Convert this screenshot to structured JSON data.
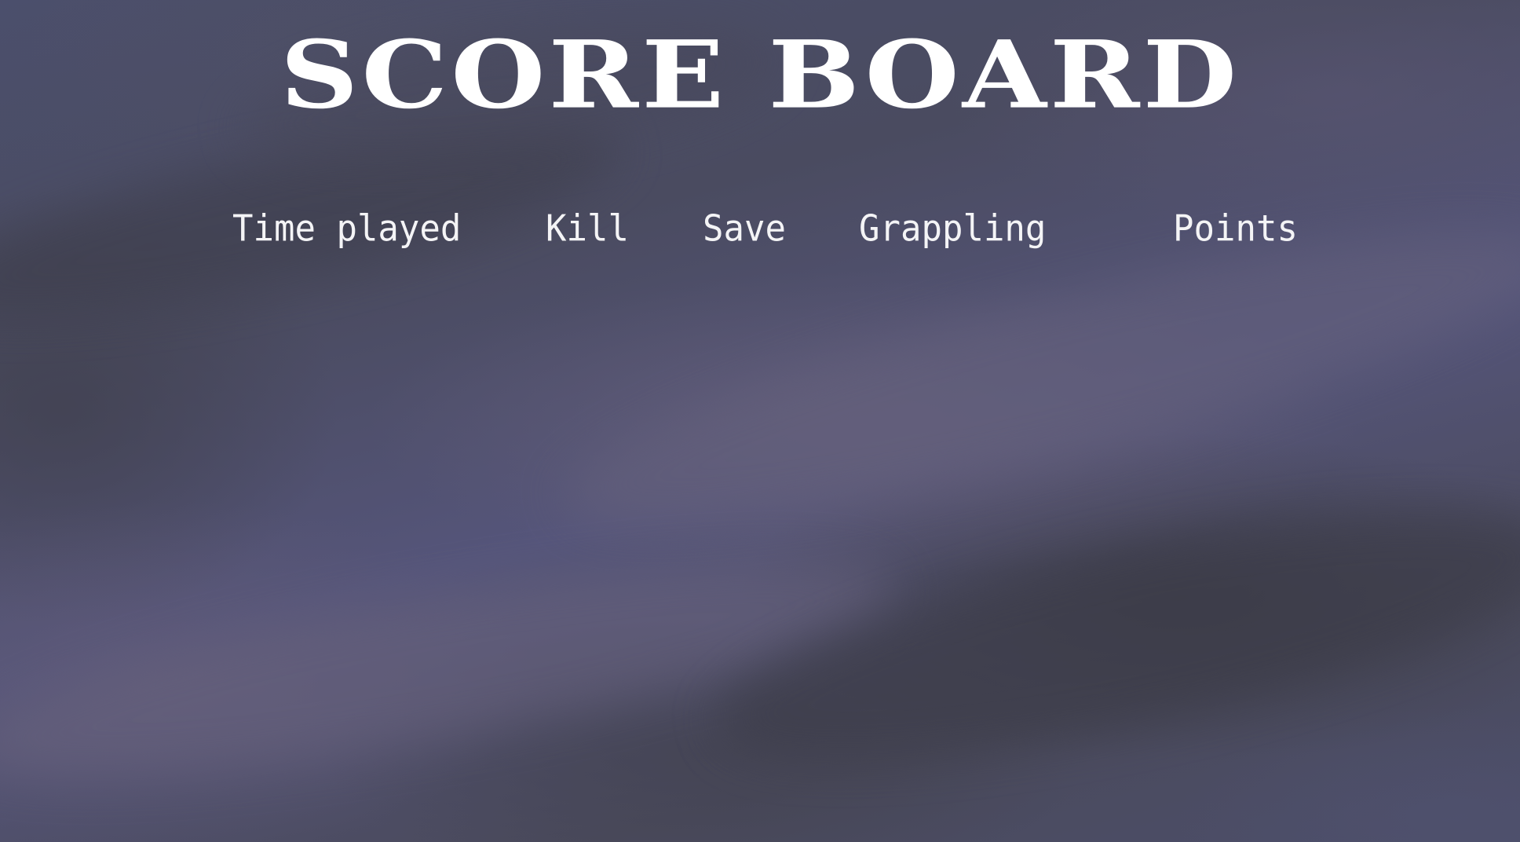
{
  "scoreboard": {
    "title": "SCORE BOARD",
    "columns": [
      "Time played",
      "Kill",
      "Save",
      "Grappling",
      "Points"
    ]
  },
  "colors": {
    "text": "#ffffff",
    "background": "#4a4d66"
  }
}
